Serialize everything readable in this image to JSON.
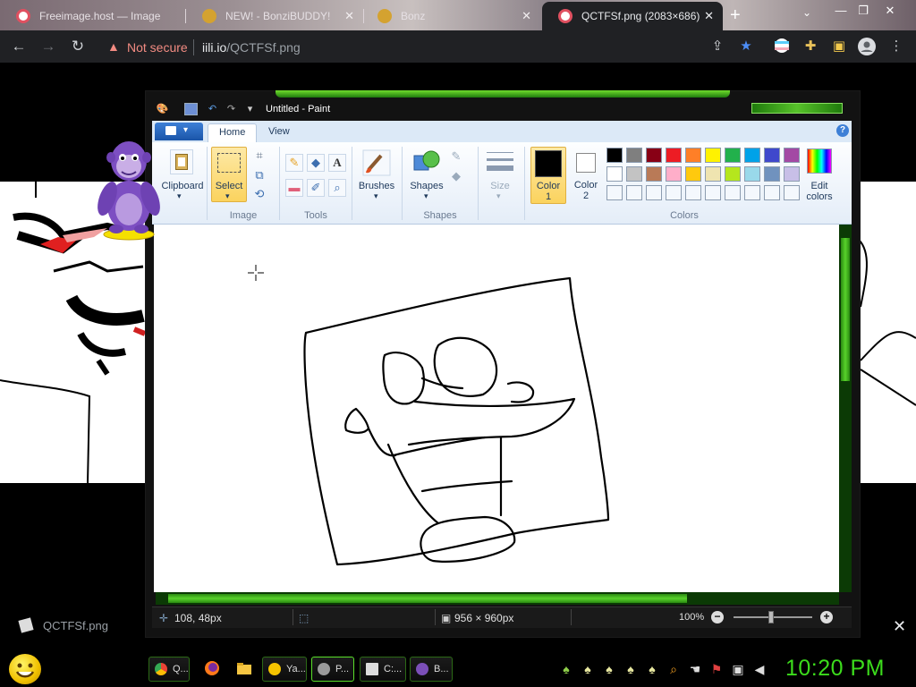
{
  "browser": {
    "tabs": [
      {
        "title": "Freeimage.host — Image",
        "active": false
      },
      {
        "title": "NEW! - BonziBUDDY!",
        "active": false
      },
      {
        "title": "Bonz",
        "active": false
      },
      {
        "title": "QCTFSf.png (2083×686)",
        "active": true
      }
    ],
    "new_tab": "+",
    "security_label": "Not secure",
    "url_host": "iili.io",
    "url_path": "/QCTFSf.png"
  },
  "viewer": {
    "file_name": "QCTFSf.png"
  },
  "paint": {
    "title": "Untitled - Paint",
    "ribbon_tabs": [
      "Home",
      "View"
    ],
    "groups": {
      "clipboard": "Clipboard",
      "image": "Image",
      "select": "Select",
      "tools": "Tools",
      "brushes": "Brushes",
      "shapes_btn": "Shapes",
      "shapes": "Shapes",
      "size": "Size",
      "color1": "Color\n1",
      "color2": "Color\n2",
      "colors": "Colors",
      "edit_colors": "Edit\ncolors"
    },
    "palette_row1": [
      "#000000",
      "#7f7f7f",
      "#880015",
      "#ed1c24",
      "#ff7f27",
      "#fff200",
      "#22b14c",
      "#00a2e8",
      "#3f48cc",
      "#a349a4"
    ],
    "palette_row2": [
      "#ffffff",
      "#c3c3c3",
      "#b97a57",
      "#ffaec9",
      "#ffc90e",
      "#efe4b0",
      "#b5e61d",
      "#99d9ea",
      "#7092be",
      "#c8bfe7"
    ],
    "color1": "#000000",
    "color2": "#ffffff",
    "status": {
      "cursor_pos": "108, 48px",
      "canvas_size": "956 × 960px",
      "zoom": "100%"
    }
  },
  "taskbar": {
    "items": [
      {
        "label": "Q...",
        "color": "#4285f4"
      },
      {
        "label": "Ya...",
        "color": "#f5c400"
      },
      {
        "label": "P...",
        "color": "#9a9a9a"
      },
      {
        "label": "C:...",
        "color": "#dddddd"
      },
      {
        "label": "B...",
        "color": "#7b4fb8"
      }
    ],
    "clock": "10:20 PM"
  }
}
